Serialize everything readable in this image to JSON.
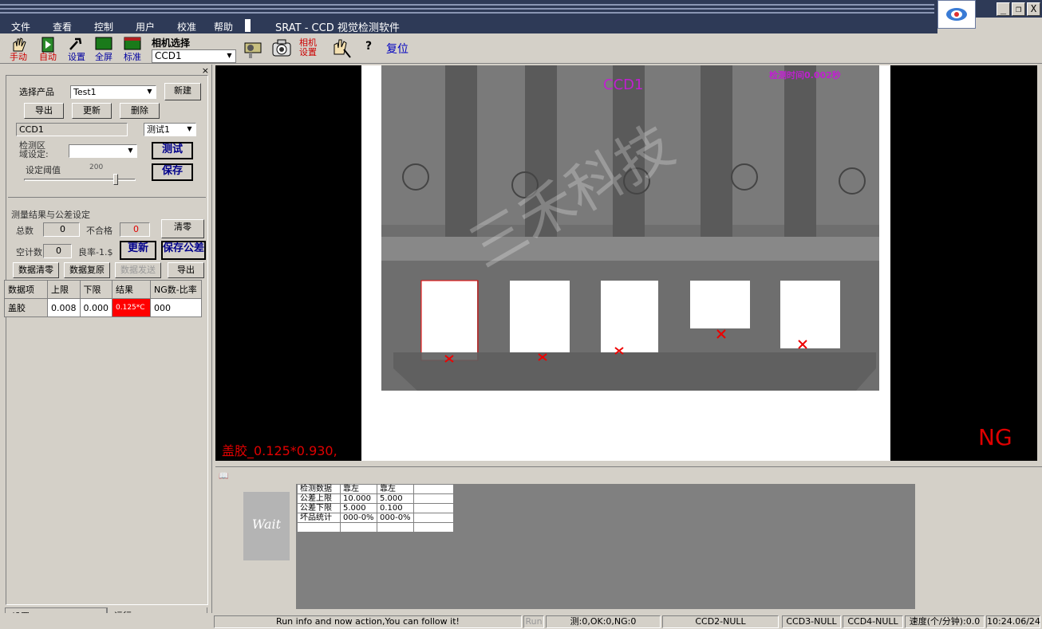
{
  "window": {
    "title": "SRAT - CCD 视觉检测软件",
    "controls": [
      "_",
      "❐",
      "X"
    ]
  },
  "menu": {
    "items": [
      "文件",
      "查看",
      "控制",
      "用户",
      "校准",
      "帮助"
    ]
  },
  "toolbar": {
    "manual": "手动",
    "auto": "自动",
    "settings": "设置",
    "fullscreen": "全屏",
    "standard": "标准",
    "camera_select_title": "相机选择",
    "camera_selected": "CCD1",
    "camera_settings": "相机\n设置",
    "reset": "复位"
  },
  "left": {
    "select_product_label": "选择产品",
    "product_value": "Test1",
    "new_button": "新建",
    "export_button": "导出",
    "update_button": "更新",
    "delete_button": "删除",
    "ccd_value": "CCD1",
    "test_select_value": "测试1",
    "region_label": "检测区\n域设定:",
    "test_button": "测试",
    "save_button": "保存",
    "threshold_label": "设定阈值",
    "threshold_value": "200",
    "threshold_level": 0.82,
    "section_title": "测量结果与公差设定",
    "total_label": "总数",
    "total_value": "0",
    "ng_label": "不合格",
    "ng_value": "0",
    "clear_button": "清零",
    "empty_count_label": "空计数",
    "empty_count_value": "0",
    "yield_label": "良率-1.$",
    "update2_button": "更新",
    "save_tolerance_button": "保存公差",
    "data_clear_button": "数据清零",
    "data_restore_button": "数据复原",
    "data_send_button": "数据发送",
    "export2_button": "导出",
    "table_headers": [
      "数据项",
      "上限",
      "下限",
      "结果",
      "NG数-比率"
    ],
    "table_row": [
      "盖胶",
      "0.008",
      "0.000",
      "0.125*C",
      "000"
    ]
  },
  "viewer": {
    "ccd_label": "CCD1",
    "timing_label": "检测时间0.002秒",
    "result_text": "盖胶_0.125*0.930,",
    "status": "NG",
    "watermark": "三禾科技"
  },
  "bottom": {
    "wait_label": "Wait",
    "table": [
      [
        "检测数据",
        "靠左",
        "靠左",
        ""
      ],
      [
        "公差上限",
        "10.000",
        "5.000",
        ""
      ],
      [
        "公差下限",
        "5.000",
        "0.100",
        ""
      ],
      [
        "坏品统计",
        "000-0%",
        "000-0%",
        ""
      ],
      [
        "",
        "",
        "",
        ""
      ]
    ]
  },
  "tabs": {
    "settings": "设置",
    "run": "运行"
  },
  "status_bar": {
    "info": "Run info and now action,You can follow it!",
    "mode": "Run",
    "counts": "测:0,OK:0,NG:0",
    "ccd2": "CCD2-NULL",
    "ccd3": "CCD3-NULL",
    "ccd4": "CCD4-NULL",
    "speed": "速度(个/分钟):0.0",
    "time": "10:24.06/24"
  },
  "colors": {
    "titlebar": "#2e3a57",
    "ng_red": "#e00000",
    "ccd_magenta": "#c020d0",
    "face": "#d4d0c8"
  }
}
